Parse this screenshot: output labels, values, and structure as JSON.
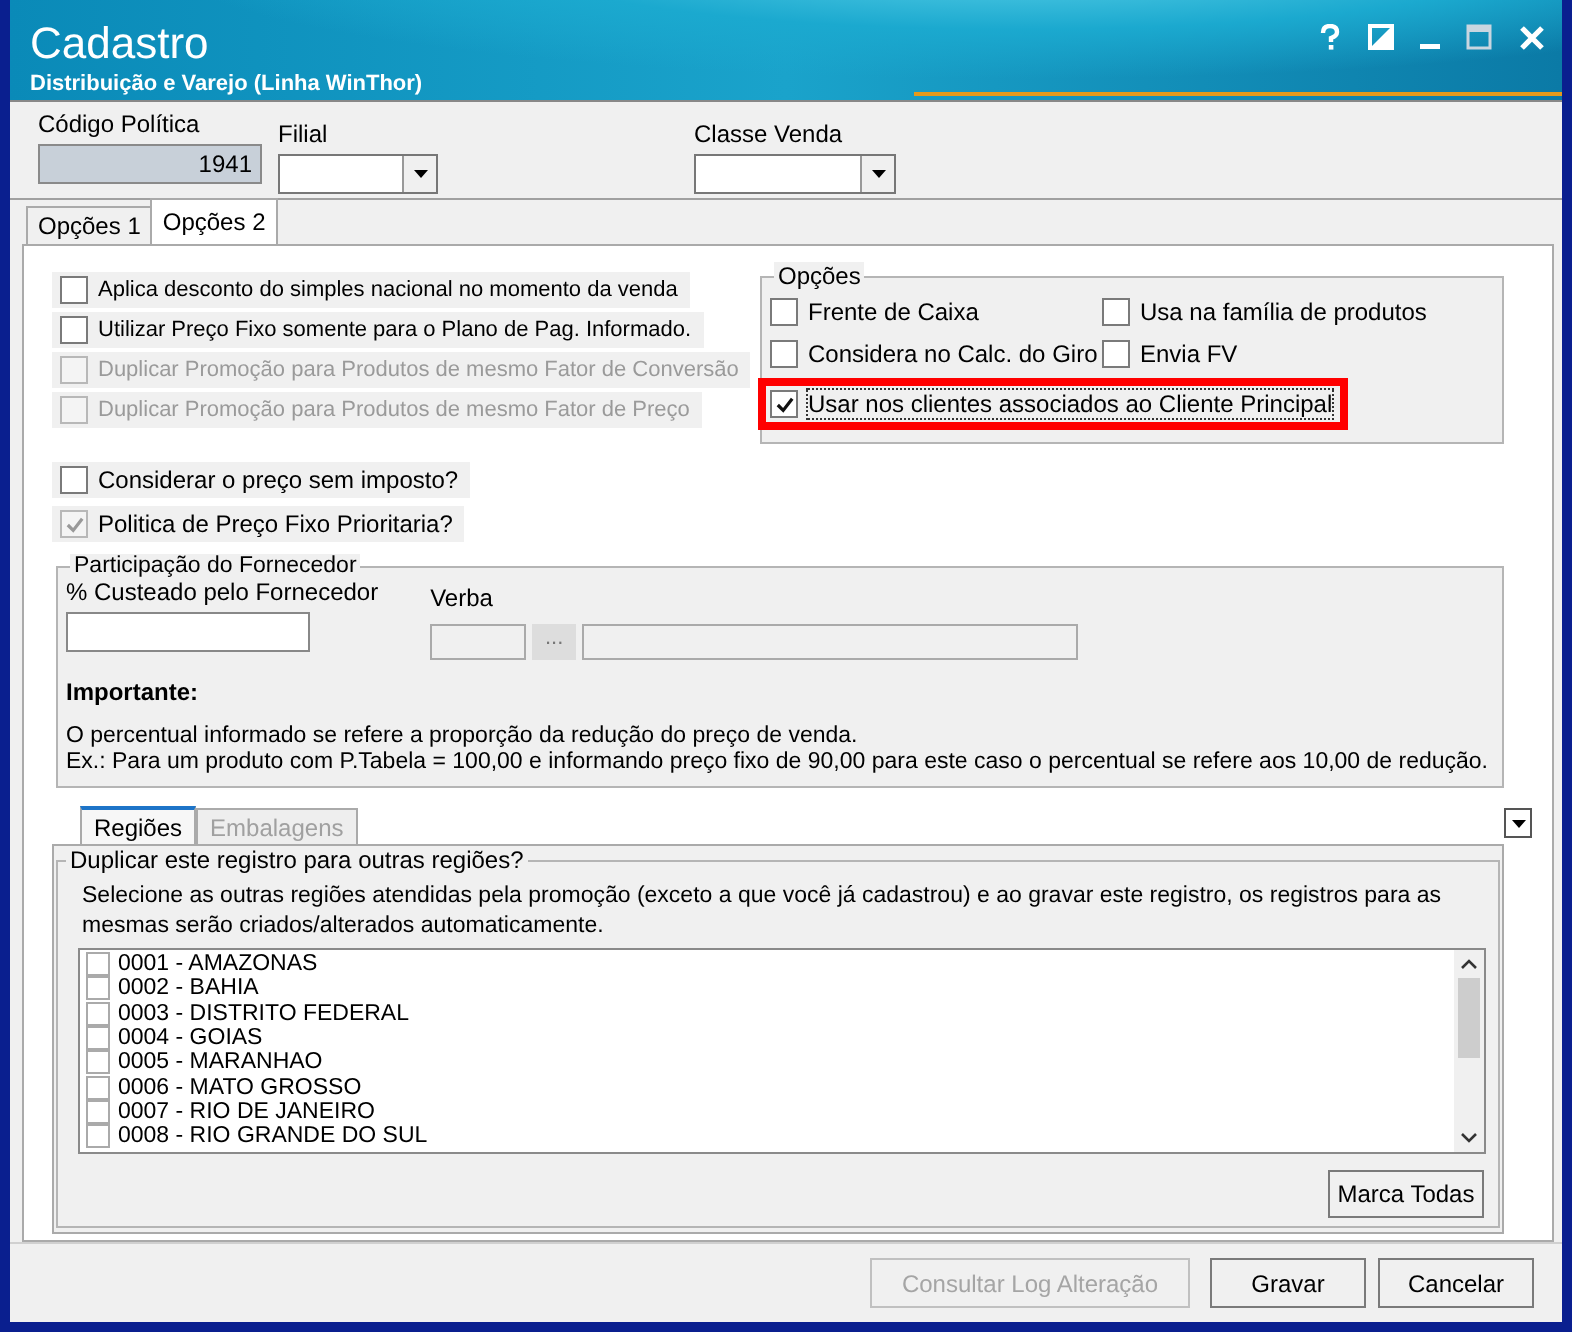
{
  "window": {
    "title": "Cadastro",
    "subtitle": "Distribuição e Varejo (Linha WinThor)"
  },
  "header_fields": [
    {
      "label": "Código Política",
      "value": "1941",
      "kind": "readonly"
    },
    {
      "label": "Filial",
      "kind": "dropdown"
    },
    {
      "label": "Classe Venda",
      "kind": "dropdown"
    }
  ],
  "tabs": [
    {
      "label": "Opções 1",
      "selected": false
    },
    {
      "label": "Opções 2",
      "selected": true
    }
  ],
  "options_left": [
    {
      "label": "Aplica desconto do simples nacional no momento da venda",
      "checked": false,
      "disabled": false
    },
    {
      "label": "Utilizar Preço Fixo somente para o Plano de Pag. Informado.",
      "checked": false,
      "disabled": false
    },
    {
      "label": "Duplicar Promoção para Produtos de mesmo Fator de Conversão",
      "checked": false,
      "disabled": true
    },
    {
      "label": "Duplicar Promoção para Produtos de mesmo Fator de Preço",
      "checked": false,
      "disabled": true
    }
  ],
  "options_group": {
    "title": "Opções",
    "items": [
      {
        "label": "Frente de Caixa",
        "checked": false,
        "highlighted": false
      },
      {
        "label": "Usa na família de produtos",
        "checked": false,
        "highlighted": false
      },
      {
        "label": "Considera no Calc. do Giro",
        "checked": false,
        "highlighted": false
      },
      {
        "label": "Envia FV",
        "checked": false,
        "highlighted": false
      },
      {
        "label": "Usar nos clientes associados ao Cliente Principal",
        "checked": true,
        "highlighted": true
      }
    ]
  },
  "options_lower": [
    {
      "label": "Considerar o preço sem imposto?",
      "checked": false,
      "disabled": false
    },
    {
      "label": "Politica de Preço Fixo Prioritaria?",
      "checked": true,
      "disabled": true
    }
  ],
  "supplier": {
    "title": "Participação do Fornecedor",
    "cost_label": "% Custeado pelo Fornecedor",
    "verba_label": "Verba",
    "verba_button": "...",
    "important_title": "Importante:",
    "important_lines": [
      "O percentual informado se refere a proporção da redução do preço de venda.",
      "Ex.: Para um produto com P.Tabela = 100,00 e informando preço fixo de 90,00 para este caso o percentual se refere aos 10,00 de redução."
    ]
  },
  "sub_tabs": [
    {
      "label": "Regiões",
      "selected": true,
      "disabled": false
    },
    {
      "label": "Embalagens",
      "selected": false,
      "disabled": true
    }
  ],
  "regions": {
    "title": "Duplicar este registro para outras regiões?",
    "description": "Selecione as outras regiões atendidas pela promoção (exceto a que você já cadastrou) e ao gravar este registro, os registros para as mesmas serão criados/alterados automaticamente.",
    "items": [
      {
        "label": "0001 - AMAZONAS",
        "checked": false
      },
      {
        "label": "0002 - BAHIA",
        "checked": false
      },
      {
        "label": "0003 - DISTRITO FEDERAL",
        "checked": false
      },
      {
        "label": "0004 - GOIAS",
        "checked": false
      },
      {
        "label": "0005 - MARANHAO",
        "checked": false
      },
      {
        "label": "0006 - MATO GROSSO",
        "checked": false
      },
      {
        "label": "0007 - RIO DE JANEIRO",
        "checked": false
      },
      {
        "label": "0008 - RIO GRANDE DO SUL",
        "checked": false
      }
    ],
    "button": "Marca Todas"
  },
  "buttons": [
    {
      "label": "Consultar Log Alteração",
      "disabled": true
    },
    {
      "label": "Gravar",
      "disabled": false
    },
    {
      "label": "Cancelar",
      "disabled": false
    }
  ]
}
